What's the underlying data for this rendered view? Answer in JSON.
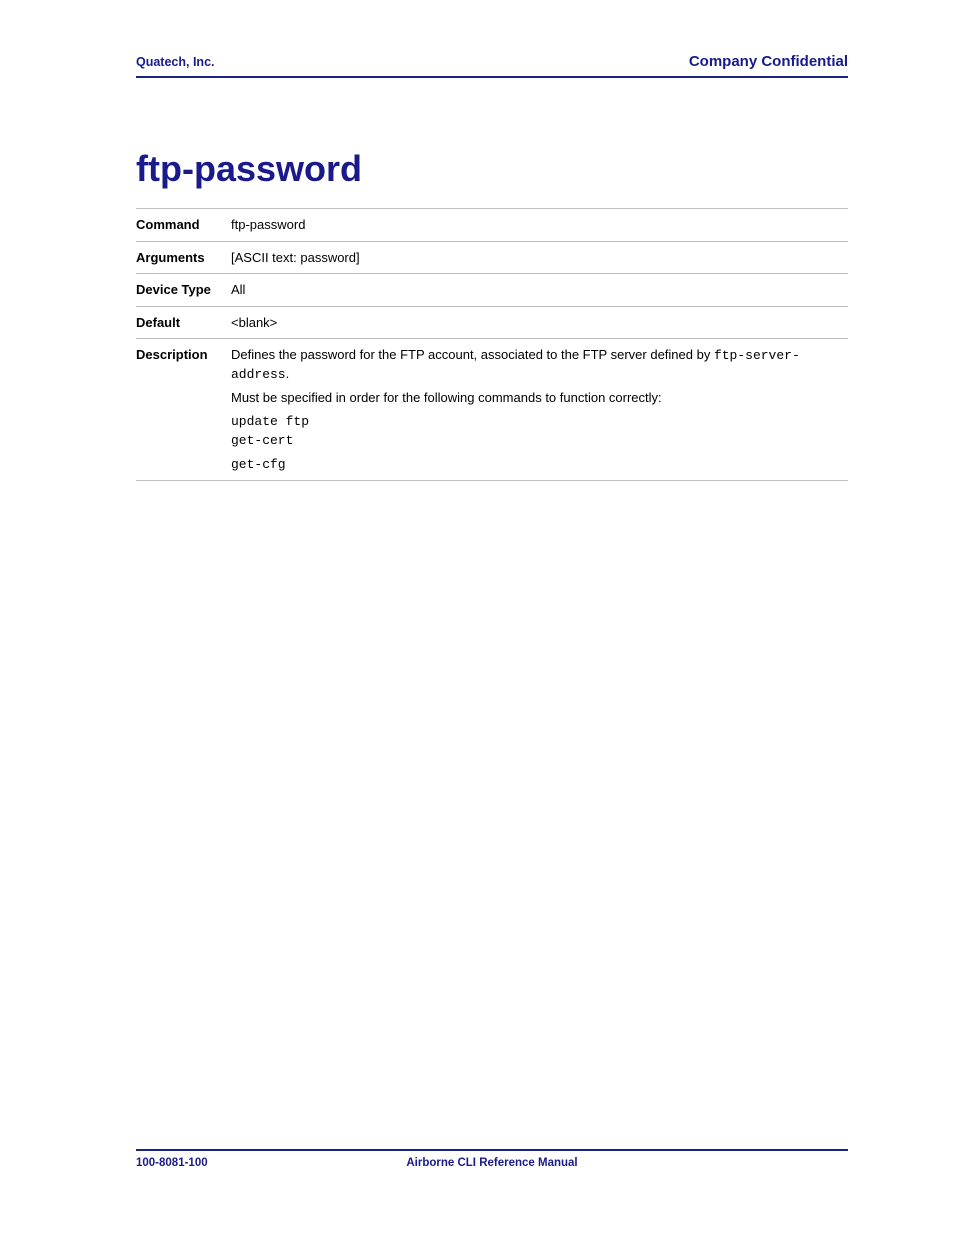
{
  "header": {
    "left": "Quatech, Inc.",
    "right": "Company Confidential"
  },
  "title": "ftp-password",
  "rows": {
    "command": {
      "label": "Command",
      "value": "ftp-password"
    },
    "arguments": {
      "label": "Arguments",
      "value": "[ASCII text: password]"
    },
    "device_type": {
      "label": "Device Type",
      "value": "All"
    },
    "default": {
      "label": "Default",
      "value": "<blank>"
    },
    "description": {
      "label": "Description",
      "p1_a": "Defines the password for the FTP account, associated to the FTP server defined by ",
      "p1_code": "ftp-server-address",
      "p1_b": ".",
      "p2": "Must be specified in order for the following commands to function correctly:",
      "code1": "update ftp",
      "code2": "get-cert",
      "code3": "get-cfg"
    }
  },
  "footer": {
    "left": "100-8081-100",
    "center": "Airborne CLI Reference Manual",
    "right": ""
  }
}
